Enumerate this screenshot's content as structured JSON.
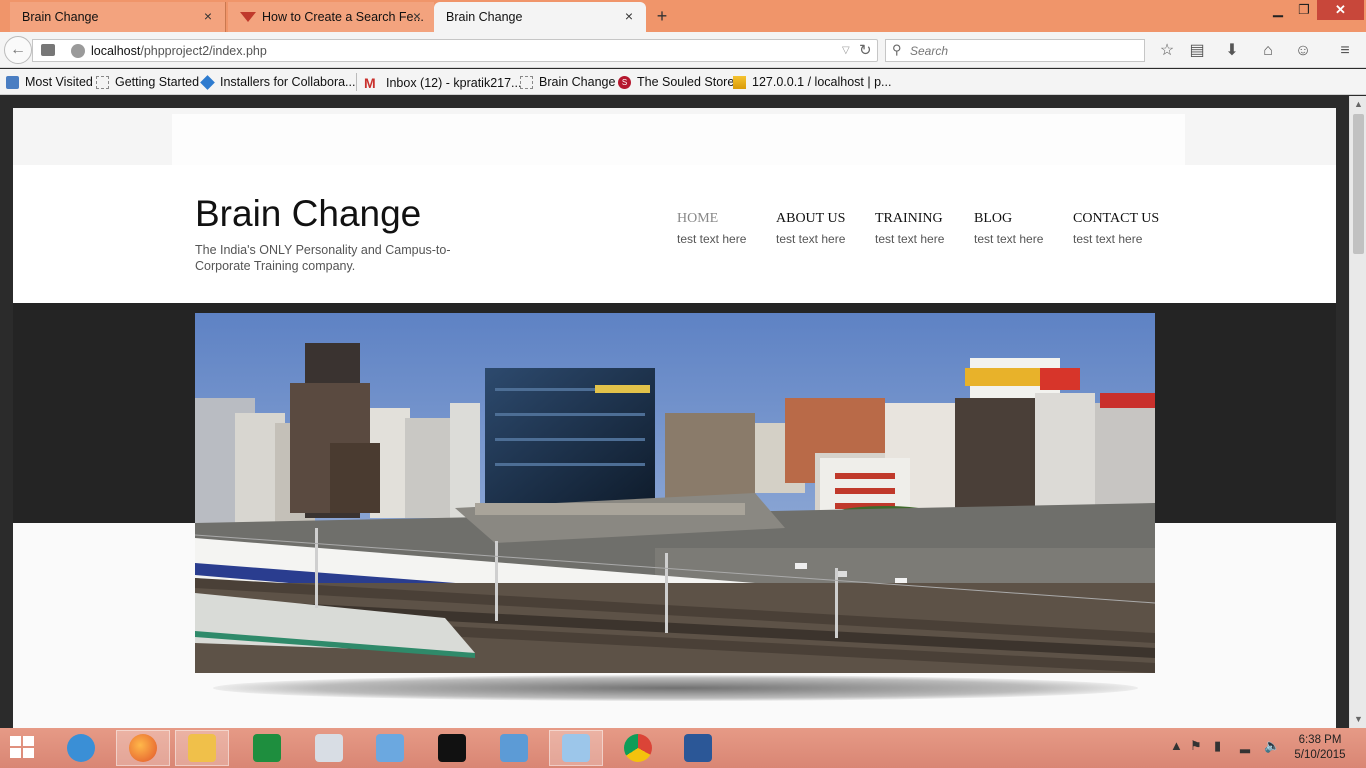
{
  "browser": {
    "tabs": [
      {
        "label": "Brain Change"
      },
      {
        "label": "How to Create a Search Fe..."
      },
      {
        "label": "Brain Change"
      }
    ],
    "url_host": "localhost",
    "url_path": "/phpproject2/index.php",
    "search_placeholder": "Search",
    "bookmarks": [
      "Most Visited",
      "Getting Started",
      "Installers for Collabora...",
      "Inbox (12) - kpratik217...",
      "Brain Change",
      "The Souled Store",
      "127.0.0.1 / localhost | p..."
    ]
  },
  "site": {
    "title": "Brain Change",
    "tagline": "The India's ONLY Personality and Campus-to-Corporate Training company.",
    "menu": [
      {
        "label": "HOME",
        "sub": "test text here",
        "active": true
      },
      {
        "label": "ABOUT US",
        "sub": "test text here"
      },
      {
        "label": "TRAINING",
        "sub": "test text here"
      },
      {
        "label": "BLOG",
        "sub": "test text here"
      },
      {
        "label": "CONTACT US",
        "sub": "test text here"
      }
    ]
  },
  "taskbar": {
    "time": "6:38 PM",
    "date": "5/10/2015"
  }
}
